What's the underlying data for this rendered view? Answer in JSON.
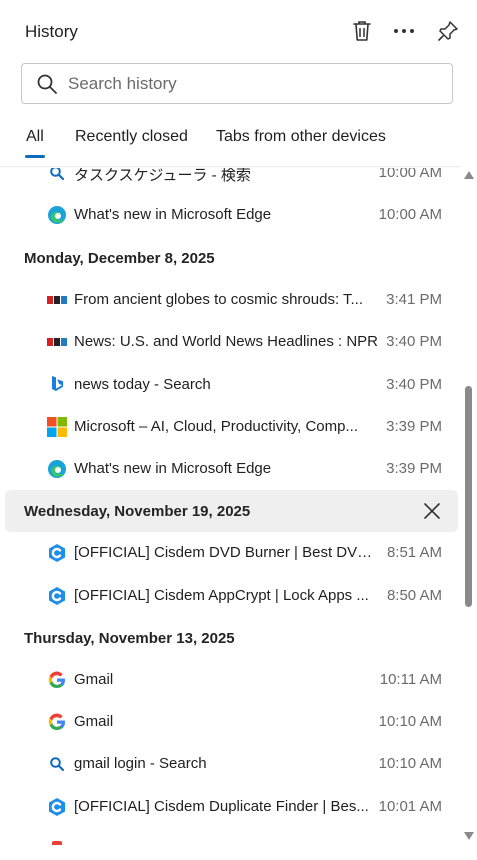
{
  "header": {
    "title": "History",
    "delete_icon": "trash-icon",
    "more_icon": "more-icon",
    "pin_icon": "pin-icon"
  },
  "search": {
    "placeholder": "Search history",
    "value": ""
  },
  "tabs": [
    {
      "label": "All",
      "active": true
    },
    {
      "label": "Recently closed",
      "active": false
    },
    {
      "label": "Tabs from other devices",
      "active": false
    }
  ],
  "accent_color": "#0f6cbd",
  "history": {
    "top_items": [
      {
        "title": "タスクスケジューラ - 検索",
        "time": "10:00 AM",
        "icon": "bing-search-icon"
      },
      {
        "title": "What's new in Microsoft Edge",
        "time": "10:00 AM",
        "icon": "edge-icon"
      }
    ],
    "groups": [
      {
        "date": "Monday, December 8, 2025",
        "items": [
          {
            "title": "From ancient globes to cosmic shrouds: T...",
            "time": "3:41 PM",
            "icon": "npr-icon"
          },
          {
            "title": "News: U.S. and World News Headlines : NPR",
            "time": "3:40 PM",
            "icon": "npr-icon"
          },
          {
            "title": "news today - Search",
            "time": "3:40 PM",
            "icon": "bing-icon"
          },
          {
            "title": "Microsoft – AI, Cloud, Productivity, Comp...",
            "time": "3:39 PM",
            "icon": "microsoft-icon"
          },
          {
            "title": "What's new in Microsoft Edge",
            "time": "3:39 PM",
            "icon": "edge-icon"
          }
        ]
      },
      {
        "date": "Wednesday, November 19, 2025",
        "items": [
          {
            "title": "[OFFICIAL] Cisdem DVD Burner | Best DVD...",
            "time": "8:51 AM",
            "icon": "cisdem-icon"
          },
          {
            "title": "[OFFICIAL] Cisdem AppCrypt | Lock Apps ...",
            "time": "8:50 AM",
            "icon": "cisdem-icon"
          }
        ]
      },
      {
        "date": "Thursday, November 13, 2025",
        "items": [
          {
            "title": "Gmail",
            "time": "10:11 AM",
            "icon": "google-icon"
          },
          {
            "title": "Gmail",
            "time": "10:10 AM",
            "icon": "google-icon"
          },
          {
            "title": "gmail login - Search",
            "time": "10:10 AM",
            "icon": "bing-search-icon"
          },
          {
            "title": "[OFFICIAL] Cisdem Duplicate Finder | Bes...",
            "time": "10:01 AM",
            "icon": "cisdem-icon"
          }
        ]
      }
    ],
    "hovered_group_close_icon": "close-icon"
  }
}
